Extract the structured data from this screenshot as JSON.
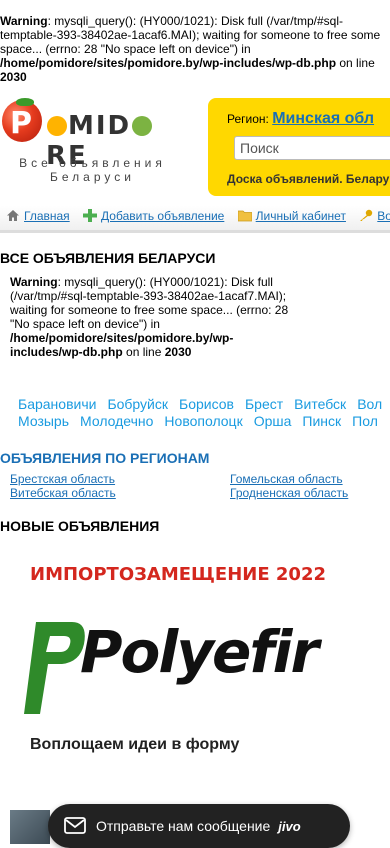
{
  "top_warning": {
    "label": "Warning",
    "text": ": mysqli_query(): (HY000/1021): Disk full (/var/tmp/#sql-temptable-393-38402ae-1acaf6.MAI); waiting for someone to free some space... (errno: 28 \"No space left on device\") in",
    "path": "/home/pomidore/sites/pomidore.by/wp-includes/wp-db.php",
    "on_line": "on line",
    "line": "2030"
  },
  "logo": {
    "text_a": "P",
    "text_b": "MID",
    "text_c": "RE",
    "tagline": "Все объявления Беларуси"
  },
  "header": {
    "region_label": "Регион:",
    "region_value": "Минская обл",
    "search_placeholder": "Поиск",
    "slogan": "Доска объявлений. Белару"
  },
  "nav": [
    {
      "label": "Главная",
      "icon": "home-icon"
    },
    {
      "label": "Добавить объявление",
      "icon": "plus-icon"
    },
    {
      "label": "Личный кабинет",
      "icon": "folder-icon"
    },
    {
      "label": "Вой",
      "icon": "key-icon"
    }
  ],
  "section_title": "ВСЕ ОБЪЯВЛЕНИЯ БЕЛАРУСИ",
  "inner_warning": {
    "label": "Warning",
    "text": ": mysqli_query(): (HY000/1021): Disk full (/var/tmp/#sql-temptable-393-38402ae-1acaf7.MAI); waiting for someone to free some space... (errno: 28 \"No space left on device\") in",
    "path": "/home/pomidore/sites/pomidore.by/wp-includes/wp-db.php",
    "on_line": "on line",
    "line": "2030"
  },
  "cities_row1": [
    "Барановичи",
    "Бобруйск",
    "Борисов",
    "Брест",
    "Витебск",
    "Вол"
  ],
  "cities_row2": [
    "Мозырь",
    "Молодечно",
    "Новополоцк",
    "Орша",
    "Пинск",
    "Пол"
  ],
  "regions_title": "ОБЪЯВЛЕНИЯ ПО РЕГИОНАМ",
  "regions": [
    "Брестская область",
    "Гомельская область",
    "Витебская область",
    "Гродненская область"
  ],
  "new_ads_title": "НОВЫЕ ОБЪЯВЛЕНИЯ",
  "banner": {
    "headline": "ИМПОРТОЗАМЕЩЕНИЕ 2022",
    "brand": "Polyefir",
    "subline": "Воплощаем идеи в форму"
  },
  "chat": {
    "text": "Отправьте нам сообщение",
    "brand": "jivo"
  },
  "colors": {
    "accent_yellow": "#ffd800",
    "link_blue": "#1a6fb5",
    "city_blue": "#1a9be0"
  }
}
